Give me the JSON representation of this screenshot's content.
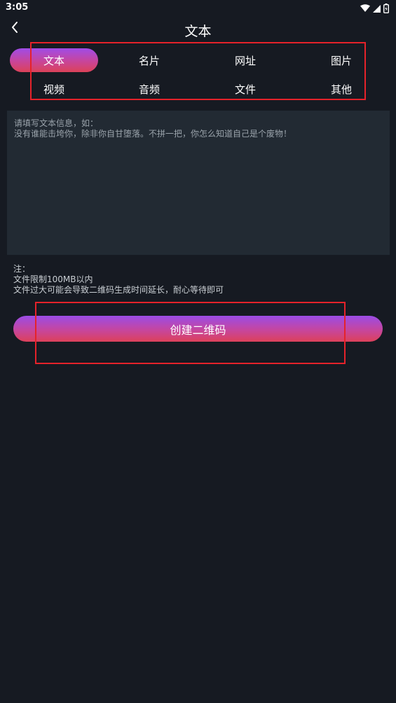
{
  "status_bar": {
    "time": "3:05",
    "icons": [
      "wifi-icon",
      "signal-icon",
      "battery-icon"
    ]
  },
  "header": {
    "back_icon": "chevron-left-icon",
    "title": "文本"
  },
  "tabs": [
    {
      "label": "文本",
      "active": true
    },
    {
      "label": "名片",
      "active": false
    },
    {
      "label": "网址",
      "active": false
    },
    {
      "label": "图片",
      "active": false
    },
    {
      "label": "视频",
      "active": false
    },
    {
      "label": "音频",
      "active": false
    },
    {
      "label": "文件",
      "active": false
    },
    {
      "label": "其他",
      "active": false
    }
  ],
  "input": {
    "value": "",
    "placeholder": "请填写文本信息，如：\n没有谁能击垮你，除非你自甘堕落。不拼一把，你怎么知道自己是个废物！"
  },
  "notes": {
    "heading": "注：",
    "line1": "文件限制100MB以内",
    "line2": "文件过大可能会导致二维码生成时间延长，耐心等待即可"
  },
  "create_button": {
    "label": "创建二维码"
  },
  "colors": {
    "background": "#161a22",
    "input_background": "#222a33",
    "gradient_top": "#9b4ce6",
    "gradient_bottom": "#dd415a",
    "highlight_box": "#e5222a"
  }
}
